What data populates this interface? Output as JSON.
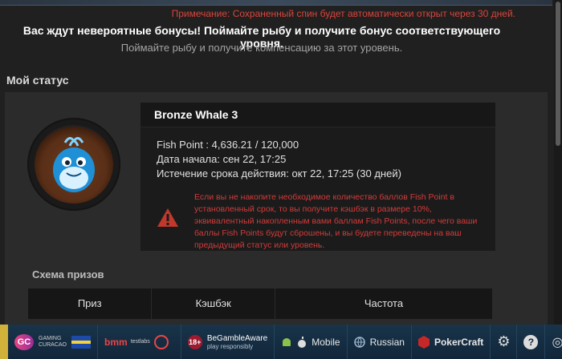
{
  "note": "Примечание: Сохраненный спин будет автоматически открыт через 30 дней.",
  "headline": "Вас ждут невероятные бонусы! Поймайте рыбу и получите бонус соответствующего уровня.",
  "subheadline": "Поймайте рыбу и получите компенсацию за этот уровень.",
  "status": {
    "title": "Мой статус",
    "level_name": "Bronze Whale 3",
    "fish_point": "Fish Point : 4,636.21 / 120,000",
    "start_date": "Дата начала: сен 22, 17:25",
    "expiry": "Истечение срока действия: окт 22, 17:25 (30 дней)",
    "warning": "Если вы не накопите необходимое количество баллов Fish Point в установленный срок, то вы получите кэшбэк в размере 10%, эквивалентный накопленным вами баллам Fish Points, после чего ваши баллы Fish Points будут сброшены, и вы будете переведены на ваш предыдущий статус или уровень.",
    "warning_color": "#d23c3a"
  },
  "prize_scheme": {
    "title": "Схема призов",
    "columns": [
      "Приз",
      "Кэшбэк",
      "Частота"
    ]
  },
  "bottom_bar": {
    "gc_logo": "GC",
    "gaming_line1": "GAMING",
    "gaming_line2": "CURACAO",
    "bmm": "bmm",
    "testlabs": "testlabs",
    "age": "18+",
    "begamble": "BeGambleAware",
    "begamble_sub": "play responsibly",
    "mobile": "Mobile",
    "language": "Russian",
    "pokercraft": "PokerCraft"
  }
}
